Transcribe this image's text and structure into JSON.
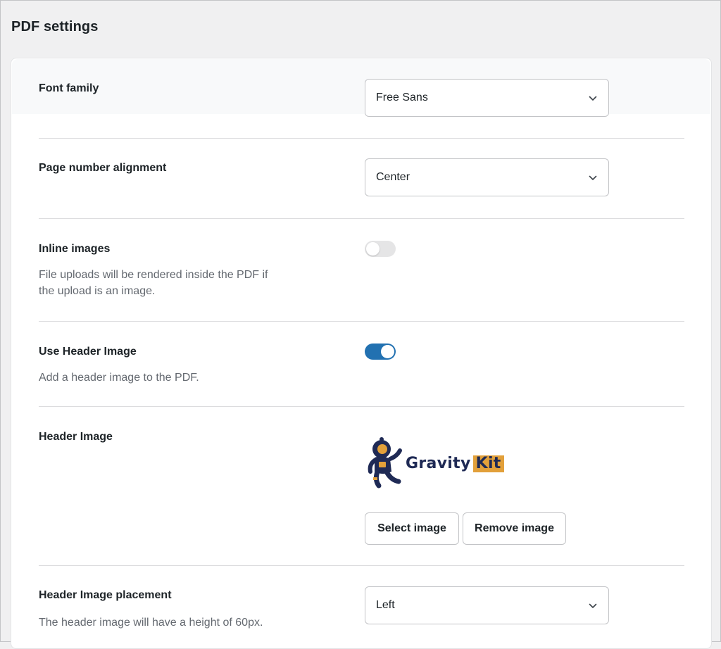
{
  "page": {
    "title": "PDF settings"
  },
  "settings": {
    "font_family": {
      "label": "Font family",
      "value": "Free Sans"
    },
    "page_number_alignment": {
      "label": "Page number alignment",
      "value": "Center"
    },
    "inline_images": {
      "label": "Inline images",
      "description_line1": "File uploads will be rendered inside the PDF if",
      "description_line2": "the upload is an image.",
      "enabled": false
    },
    "use_header_image": {
      "label": "Use Header Image",
      "description": "Add a header image to the PDF.",
      "enabled": true
    },
    "header_image": {
      "label": "Header Image",
      "logo_text": "Gravity",
      "logo_badge": "Kit",
      "select_button": "Select image",
      "remove_button": "Remove image"
    },
    "header_image_placement": {
      "label": "Header Image placement",
      "description": "The header image will have a height of 60px.",
      "value": "Left"
    }
  },
  "icons": {
    "select_arrow": "chevron-down-icon",
    "logo_mascot": "astronaut-icon"
  },
  "colors": {
    "accent": "#2271b1",
    "logo_navy": "#1f2a55",
    "logo_gold": "#e2a03a"
  }
}
